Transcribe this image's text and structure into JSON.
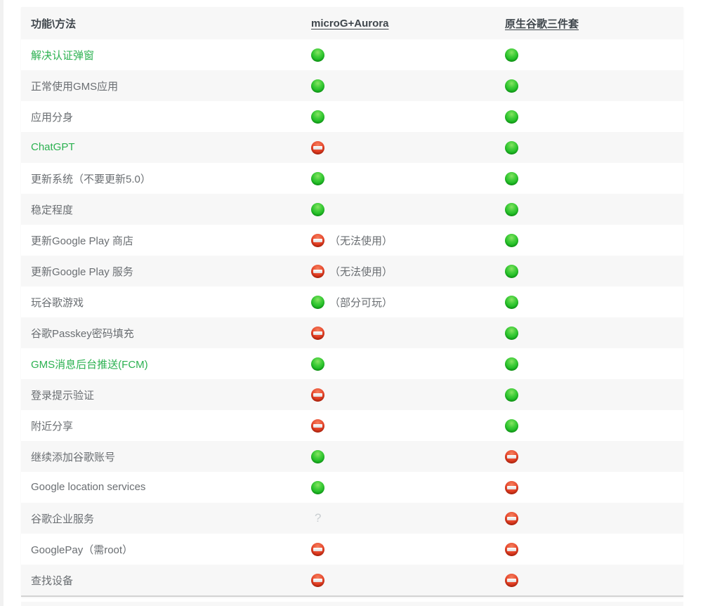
{
  "colors": {
    "accent_link_green": "#2bb150",
    "status_green": "#1cba23",
    "status_red": "#e8462b",
    "header_text": "#3f464c",
    "body_text": "#6a6e72",
    "stripe_bg": "#f7f7f7"
  },
  "icons": {
    "yes": "green-circle-icon",
    "no": "no-entry-icon",
    "unknown": "question-mark-icon",
    "question_glyph": "?"
  },
  "table": {
    "headers": [
      {
        "label": "功能\\方法",
        "link": false
      },
      {
        "label": "microG+Aurora",
        "link": true
      },
      {
        "label": "原生谷歌三件套",
        "link": true
      }
    ],
    "rows": [
      {
        "feature": "解决认证弹窗",
        "feature_link": true,
        "microg": "yes",
        "microg_note": "",
        "native": "yes"
      },
      {
        "feature": "正常使用GMS应用",
        "feature_link": false,
        "microg": "yes",
        "microg_note": "",
        "native": "yes"
      },
      {
        "feature": "应用分身",
        "feature_link": false,
        "microg": "yes",
        "microg_note": "",
        "native": "yes"
      },
      {
        "feature": "ChatGPT",
        "feature_link": true,
        "microg": "no",
        "microg_note": "",
        "native": "yes"
      },
      {
        "feature": "更新系统（不要更新5.0）",
        "feature_link": false,
        "microg": "yes",
        "microg_note": "",
        "native": "yes"
      },
      {
        "feature": "稳定程度",
        "feature_link": false,
        "microg": "yes",
        "microg_note": "",
        "native": "yes"
      },
      {
        "feature": "更新Google Play 商店",
        "feature_link": false,
        "microg": "no",
        "microg_note": "（无法使用）",
        "native": "yes"
      },
      {
        "feature": "更新Google Play 服务",
        "feature_link": false,
        "microg": "no",
        "microg_note": "（无法使用）",
        "native": "yes"
      },
      {
        "feature": "玩谷歌游戏",
        "feature_link": false,
        "microg": "yes",
        "microg_note": "（部分可玩）",
        "native": "yes"
      },
      {
        "feature": "谷歌Passkey密码填充",
        "feature_link": false,
        "microg": "no",
        "microg_note": "",
        "native": "yes"
      },
      {
        "feature": "GMS消息后台推送(FCM)",
        "feature_link": true,
        "microg": "yes",
        "microg_note": "",
        "native": "yes"
      },
      {
        "feature": "登录提示验证",
        "feature_link": false,
        "microg": "no",
        "microg_note": "",
        "native": "yes"
      },
      {
        "feature": "附近分享",
        "feature_link": false,
        "microg": "no",
        "microg_note": "",
        "native": "yes"
      },
      {
        "feature": "继续添加谷歌账号",
        "feature_link": false,
        "microg": "yes",
        "microg_note": "",
        "native": "no"
      },
      {
        "feature": "Google location services",
        "feature_link": false,
        "microg": "yes",
        "microg_note": "",
        "native": "no"
      },
      {
        "feature": "谷歌企业服务",
        "feature_link": false,
        "microg": "unknown",
        "microg_note": "",
        "native": "no"
      },
      {
        "feature": "GooglePay（需root）",
        "feature_link": false,
        "microg": "no",
        "microg_note": "",
        "native": "no"
      },
      {
        "feature": "查找设备",
        "feature_link": false,
        "microg": "no",
        "microg_note": "",
        "native": "no"
      }
    ]
  }
}
